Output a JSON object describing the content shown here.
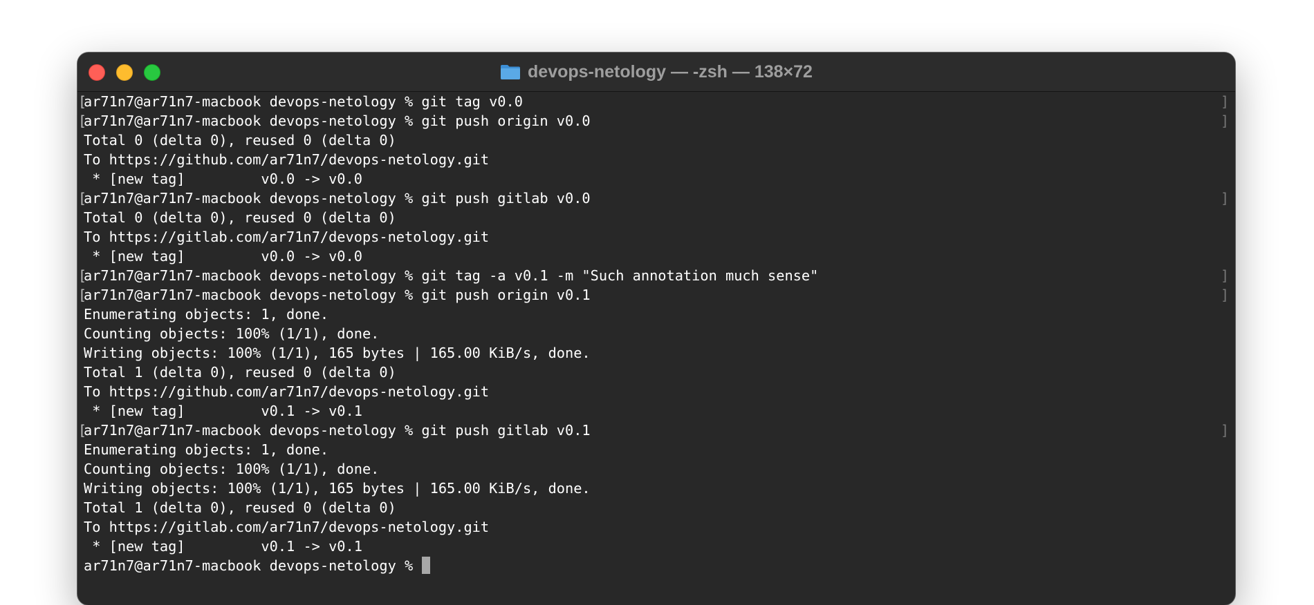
{
  "window": {
    "title": "devops-netology — -zsh — 138×72",
    "folder_icon": "folder-icon"
  },
  "terminal": {
    "lines": [
      {
        "kind": "prompt",
        "text": "ar71n7@ar71n7-macbook devops-netology % git tag v0.0"
      },
      {
        "kind": "prompt",
        "text": "ar71n7@ar71n7-macbook devops-netology % git push origin v0.0"
      },
      {
        "kind": "output",
        "text": "Total 0 (delta 0), reused 0 (delta 0)"
      },
      {
        "kind": "output",
        "text": "To https://github.com/ar71n7/devops-netology.git"
      },
      {
        "kind": "output",
        "text": " * [new tag]         v0.0 -> v0.0"
      },
      {
        "kind": "prompt",
        "text": "ar71n7@ar71n7-macbook devops-netology % git push gitlab v0.0"
      },
      {
        "kind": "output",
        "text": "Total 0 (delta 0), reused 0 (delta 0)"
      },
      {
        "kind": "output",
        "text": "To https://gitlab.com/ar71n7/devops-netology.git"
      },
      {
        "kind": "output",
        "text": " * [new tag]         v0.0 -> v0.0"
      },
      {
        "kind": "prompt",
        "text": "ar71n7@ar71n7-macbook devops-netology % git tag -a v0.1 -m \"Such annotation much sense\""
      },
      {
        "kind": "prompt",
        "text": "ar71n7@ar71n7-macbook devops-netology % git push origin v0.1"
      },
      {
        "kind": "output",
        "text": "Enumerating objects: 1, done."
      },
      {
        "kind": "output",
        "text": "Counting objects: 100% (1/1), done."
      },
      {
        "kind": "output",
        "text": "Writing objects: 100% (1/1), 165 bytes | 165.00 KiB/s, done."
      },
      {
        "kind": "output",
        "text": "Total 1 (delta 0), reused 0 (delta 0)"
      },
      {
        "kind": "output",
        "text": "To https://github.com/ar71n7/devops-netology.git"
      },
      {
        "kind": "output",
        "text": " * [new tag]         v0.1 -> v0.1"
      },
      {
        "kind": "prompt",
        "text": "ar71n7@ar71n7-macbook devops-netology % git push gitlab v0.1"
      },
      {
        "kind": "output",
        "text": "Enumerating objects: 1, done."
      },
      {
        "kind": "output",
        "text": "Counting objects: 100% (1/1), done."
      },
      {
        "kind": "output",
        "text": "Writing objects: 100% (1/1), 165 bytes | 165.00 KiB/s, done."
      },
      {
        "kind": "output",
        "text": "Total 1 (delta 0), reused 0 (delta 0)"
      },
      {
        "kind": "output",
        "text": "To https://gitlab.com/ar71n7/devops-netology.git"
      },
      {
        "kind": "output",
        "text": " * [new tag]         v0.1 -> v0.1"
      }
    ],
    "current_prompt": "ar71n7@ar71n7-macbook devops-netology % "
  },
  "colors": {
    "background": "#282828",
    "text": "#ffffff",
    "close": "#ff5f57",
    "minimize": "#febc2e",
    "zoom": "#28c840",
    "folder": "#5aa9e6"
  }
}
